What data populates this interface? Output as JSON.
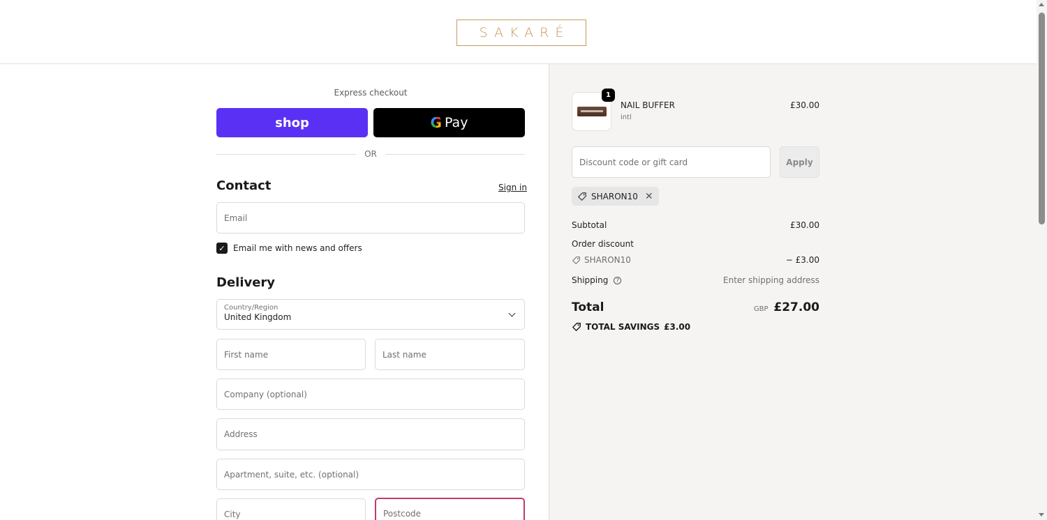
{
  "brand": {
    "name": "SAKARÉ",
    "color": "#c49a5a"
  },
  "express": {
    "label": "Express checkout",
    "shop_label": "shop",
    "gpay_g": "G",
    "gpay_label": "Pay",
    "shop_color": "#5a31f4"
  },
  "divider": {
    "or_label": "OR"
  },
  "contact": {
    "title": "Contact",
    "signin_label": "Sign in",
    "email_placeholder": "Email",
    "newsletter_label": "Email me with news and offers",
    "newsletter_checked": true
  },
  "delivery": {
    "title": "Delivery",
    "country_label": "Country/Region",
    "country_value": "United Kingdom",
    "first_name_placeholder": "First name",
    "last_name_placeholder": "Last name",
    "company_placeholder": "Company (optional)",
    "address_placeholder": "Address",
    "apartment_placeholder": "Apartment, suite, etc. (optional)",
    "city_placeholder": "City",
    "postcode_placeholder": "Postcode",
    "error_color": "#c3386e"
  },
  "summary": {
    "product": {
      "name": "NAIL BUFFER",
      "variant": "intl",
      "price": "£30.00",
      "quantity": "1"
    },
    "discount_placeholder": "Discount code or gift card",
    "apply_label": "Apply",
    "applied_code": "SHARON10",
    "subtotal_label": "Subtotal",
    "subtotal_value": "£30.00",
    "order_discount_label": "Order discount",
    "order_discount_code": "SHARON10",
    "order_discount_value": "− £3.00",
    "shipping_label": "Shipping",
    "shipping_value": "Enter shipping address",
    "total_label": "Total",
    "total_currency": "GBP",
    "total_value": "£27.00",
    "savings_label": "TOTAL SAVINGS",
    "savings_value": "£3.00"
  }
}
